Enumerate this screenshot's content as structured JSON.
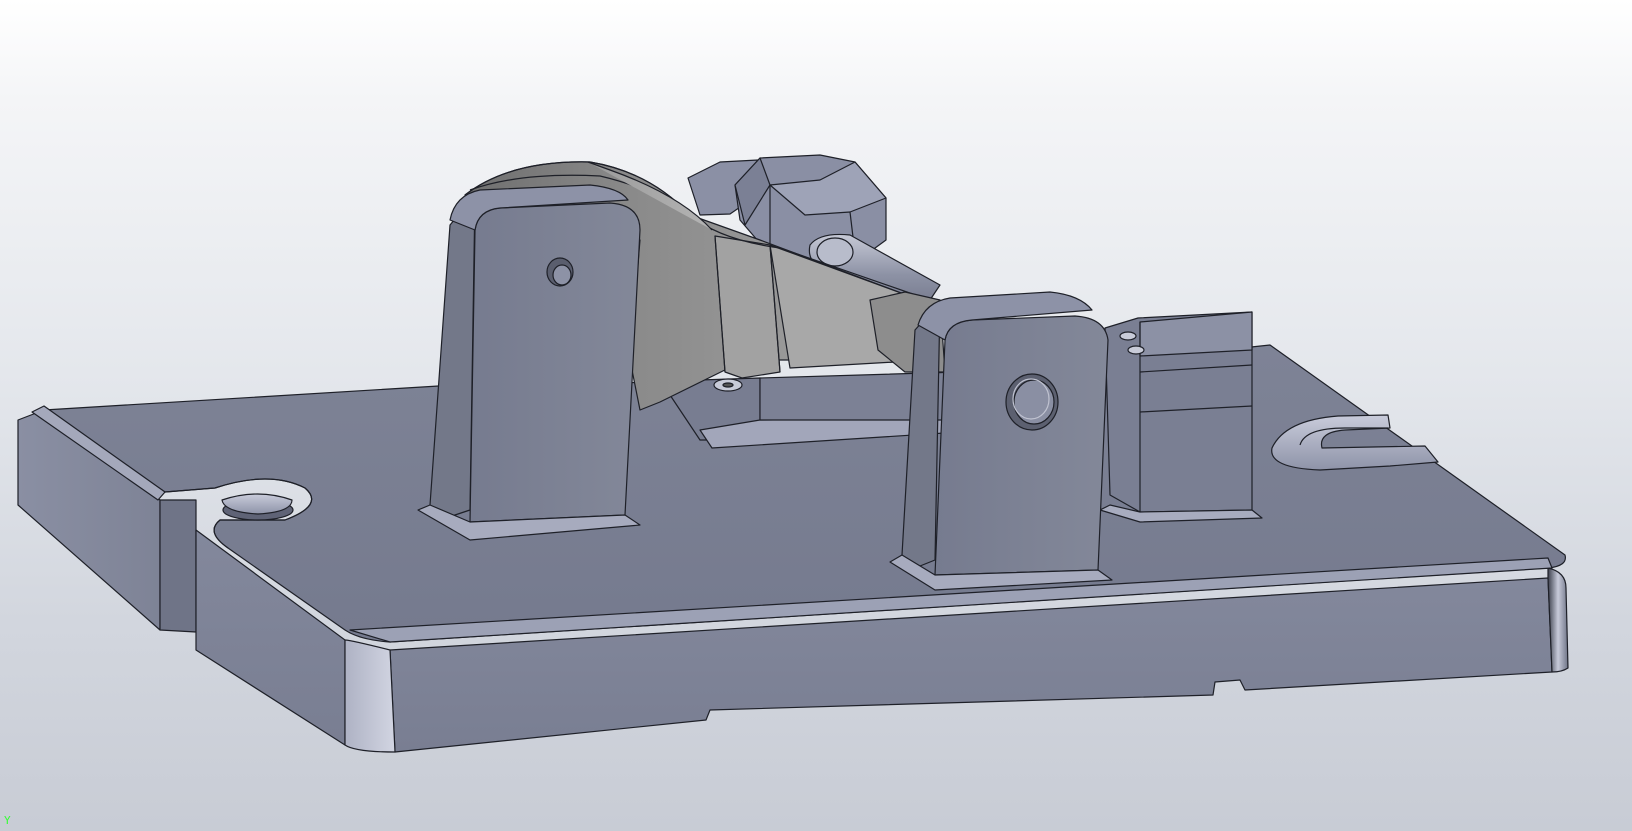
{
  "viewport": {
    "background_top": "#ffffff",
    "background_bottom": "#c8ccd5"
  },
  "model": {
    "fixture_color": "#7f8497",
    "part_color": "#9e9e9e",
    "edge_color": "#1e2028"
  },
  "axis_triad": {
    "label": "Y",
    "color": "#33ff33"
  }
}
